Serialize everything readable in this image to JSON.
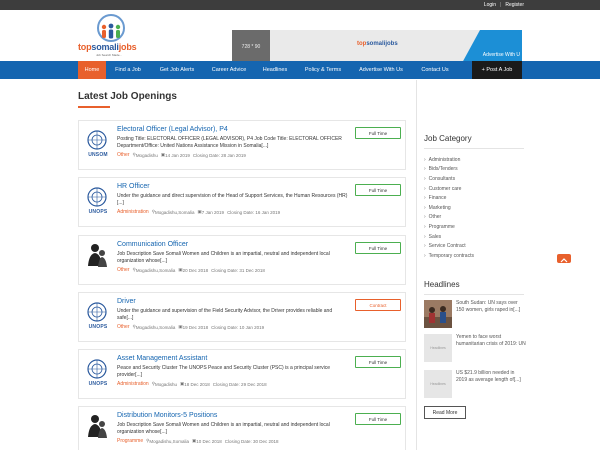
{
  "topbar": {
    "login": "Login",
    "separator": "|",
    "register": "Register"
  },
  "logo": {
    "part1": "top",
    "part2": "somali",
    "part3": "jobs",
    "tagline": "Job Search Made..."
  },
  "banner": {
    "size_label": "728 * 90",
    "logo_part1": "top",
    "logo_part2": "somalijobs",
    "advertise": "Advertise With U"
  },
  "nav": {
    "items": [
      "Home",
      "Find a Job",
      "Get Job Alerts",
      "Career Advice",
      "Headlines",
      "Policy & Terms",
      "Advertise With Us",
      "Contact Us"
    ],
    "post_job": "+ Post A Job"
  },
  "main": {
    "title": "Latest Job Openings"
  },
  "jobs": [
    {
      "org_label": "UNSOM",
      "title": "Electoral Officer (Legal Advisor), P4",
      "desc": "Posting Title: ELECTORAL OFFICER (LEGAL ADVISOR), P4 Job Code Title: ELECTORAL OFFICER Department/Office: United Nations Assistance Mission in Somalia[...]",
      "category": "Other",
      "location": "Mogadishu",
      "date": "14 Jan 2019",
      "closing": "Closing Date: 28 Jan 2019",
      "type": "Full Time"
    },
    {
      "org_label": "UNOPS",
      "title": "HR Officer",
      "desc": "Under the guidance and direct supervision of the Head of Support Services, the Human Resources (HR)[...]",
      "category": "Administration",
      "location": "Mogadishu,Somalia",
      "date": "7 Jan 2019",
      "closing": "Closing Date: 16 Jan 2019",
      "type": "Full Time"
    },
    {
      "org_label": "",
      "title": "Communication Officer",
      "desc": "Job Description Save Somali Women and Children is an impartial, neutral and independent local organization whose[...]",
      "category": "Other",
      "location": "Mogadishu,Somalia",
      "date": "20 Dec 2018",
      "closing": "Closing Date: 31 Dec 2018",
      "type": "Full Time"
    },
    {
      "org_label": "UNOPS",
      "title": "Driver",
      "desc": "Under the guidance and supervision of the Field Security Advisor, the Driver provides reliable and safe[...]",
      "category": "Other",
      "location": "Mogadishu,Somalia",
      "date": "19 Dec 2018",
      "closing": "Closing Date: 10 Jan 2019",
      "type": "Contract"
    },
    {
      "org_label": "UNOPS",
      "title": "Asset Management Assistant",
      "desc": "Peace and Security Cluster The UNOPS Peace and Security Cluster (PSC) is a principal service provider[...]",
      "category": "Administration",
      "location": "Mogadishu",
      "date": "18 Dec 2018",
      "closing": "Closing Date: 29 Dec 2018",
      "type": "Full Time"
    },
    {
      "org_label": "",
      "title": "Distribution Monitors-5 Positions",
      "desc": "Job Description Save Somali Women and Children is an impartial, neutral and independent local organization whose[...]",
      "category": "Programme",
      "location": "Mogadishu,Somalia",
      "date": "10 Dec 2018",
      "closing": "Closing Date: 30 Dec 2018",
      "type": "Full Time"
    }
  ],
  "sidebar": {
    "category_title": "Job Category",
    "categories": [
      "Administration",
      "Bids/Tenders",
      "Consultants",
      "Customer care",
      "Finance",
      "Marketing",
      "Other",
      "Programme",
      "Sales",
      "Service Contract",
      "Temporary contracts"
    ],
    "headlines_title": "Headlines",
    "headlines": [
      {
        "thumb": "",
        "text": "South Sudan: UN says over 150 women, girls raped in[...]"
      },
      {
        "thumb": "Headlines",
        "text": "Yemen to face worst humanitarian crisis of 2019: UN"
      },
      {
        "thumb": "Headlines",
        "text": "US $21.9 billion needed in 2019 as average length of[...]"
      }
    ],
    "read_more": "Read More"
  },
  "colors": {
    "nav_blue": "#1565b0",
    "accent_orange": "#e8602c",
    "topbar": "#3d3d3d",
    "badge_green": "#4caf50"
  }
}
